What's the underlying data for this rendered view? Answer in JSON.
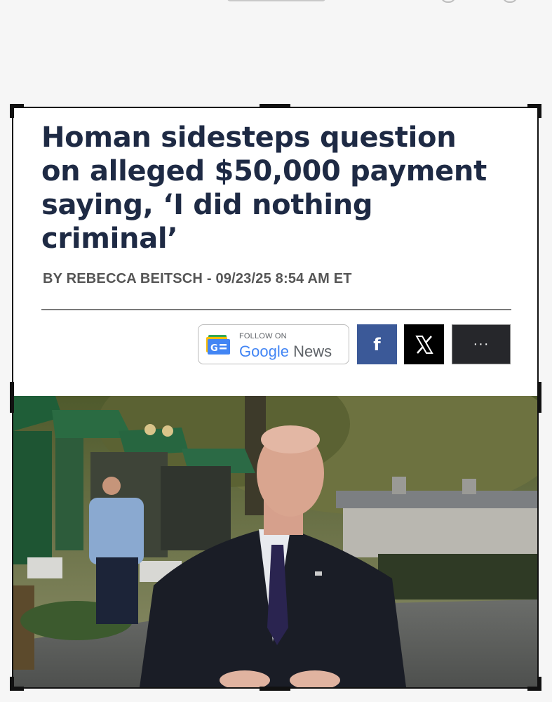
{
  "article": {
    "headline": "Homan sidesteps question on alleged $50,000 payment saying, ‘I did nothing criminal’",
    "byline": "BY REBECCA BEITSCH - 09/23/25 8:54 AM ET"
  },
  "share": {
    "google_news_follow": "FOLLOW ON",
    "google_news_label_google": "Google",
    "google_news_label_news": "News",
    "facebook_icon": "facebook-icon",
    "x_icon": "x-icon",
    "more_label": "···"
  },
  "photo": {
    "icon": "photo-image"
  },
  "colors": {
    "headline": "#1e2a44",
    "facebook": "#3b5998",
    "x": "#000000",
    "more": "#26272b"
  }
}
